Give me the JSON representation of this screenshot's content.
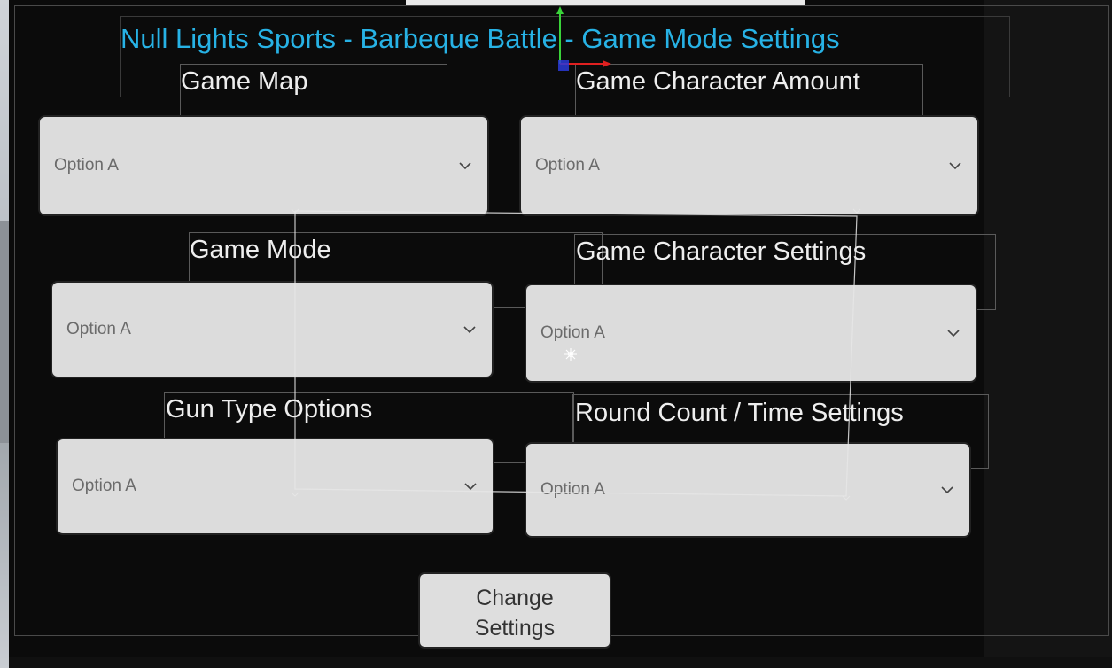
{
  "title": "Null Lights Sports - Barbeque Battle - Game Mode Settings",
  "fields": {
    "game_map": {
      "label": "Game Map",
      "value": "Option A"
    },
    "game_character_amount": {
      "label": "Game Character Amount",
      "value": "Option A"
    },
    "game_mode": {
      "label": "Game Mode",
      "value": "Option A"
    },
    "game_character_settings": {
      "label": "Game Character Settings",
      "value": "Option A"
    },
    "gun_type_options": {
      "label": "Gun Type Options",
      "value": "Option A"
    },
    "round_count_time_settings": {
      "label": "Round Count / Time Settings",
      "value": "Option A"
    }
  },
  "change_button": {
    "line1": "Change",
    "line2": "Settings"
  },
  "colors": {
    "title": "#27b2e5",
    "label": "#eeeeee",
    "dropdown_bg": "#dcdcdc",
    "dropdown_text": "#6b6b6b",
    "background": "#0b0b0b"
  },
  "icons": {
    "dropdown": "chevron-down-icon",
    "gizmo": "move-gizmo-icon",
    "cursor": "cursor-icon"
  }
}
